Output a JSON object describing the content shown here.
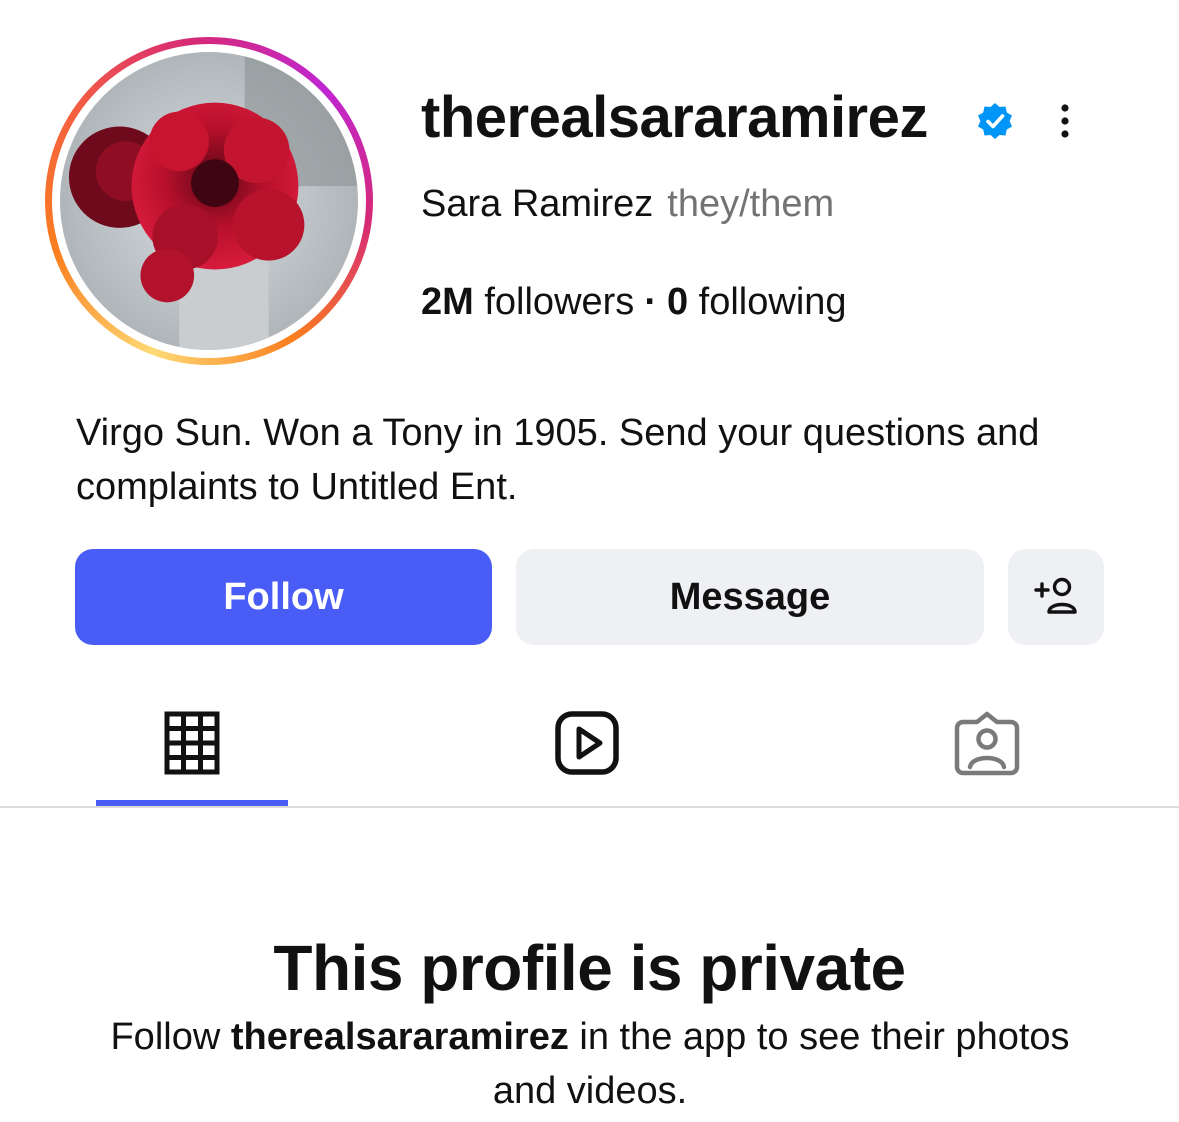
{
  "profile": {
    "username": "therealsararamirez",
    "full_name": "Sara Ramirez",
    "pronouns": "they/them",
    "verified": true,
    "avatar_icon": "red-flowers-avatar"
  },
  "stats": {
    "followers_count": "2M",
    "followers_label": "followers",
    "following_count": "0",
    "following_label": "following",
    "separator": "·"
  },
  "bio": {
    "text": "Virgo Sun. Won a Tony in 1905. Send your questions and complaints to Untitled Ent."
  },
  "actions": {
    "follow_label": "Follow",
    "message_label": "Message",
    "add_user_icon": "add-user-icon",
    "more_icon": "more-options-icon"
  },
  "tabs": [
    {
      "icon": "grid-icon",
      "active": true
    },
    {
      "icon": "reels-icon",
      "active": false
    },
    {
      "icon": "tagged-icon",
      "active": false
    }
  ],
  "private_notice": {
    "title": "This profile is private",
    "desc_prefix": "Follow ",
    "desc_username": "therealsararamirez",
    "desc_suffix": " in the app to see their photos and videos."
  },
  "colors": {
    "accent": "#4a5cf6",
    "button_secondary_bg": "#eef0f3",
    "muted_text": "#737373",
    "verified_blue": "#0095f6"
  }
}
